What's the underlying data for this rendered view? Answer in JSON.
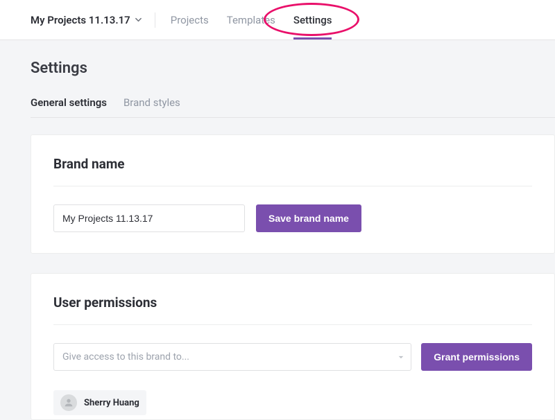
{
  "topbar": {
    "brand_name": "My Projects 11.13.17",
    "nav": {
      "projects": "Projects",
      "templates": "Templates",
      "settings": "Settings"
    }
  },
  "page": {
    "title": "Settings",
    "tabs": {
      "general": "General settings",
      "brand_styles": "Brand styles"
    }
  },
  "brand_section": {
    "heading": "Brand name",
    "input_value": "My Projects 11.13.17",
    "save_label": "Save brand name"
  },
  "permissions_section": {
    "heading": "User permissions",
    "select_placeholder": "Give access to this brand to...",
    "grant_label": "Grant permissions",
    "users": [
      {
        "name": "Sherry Huang"
      }
    ]
  }
}
